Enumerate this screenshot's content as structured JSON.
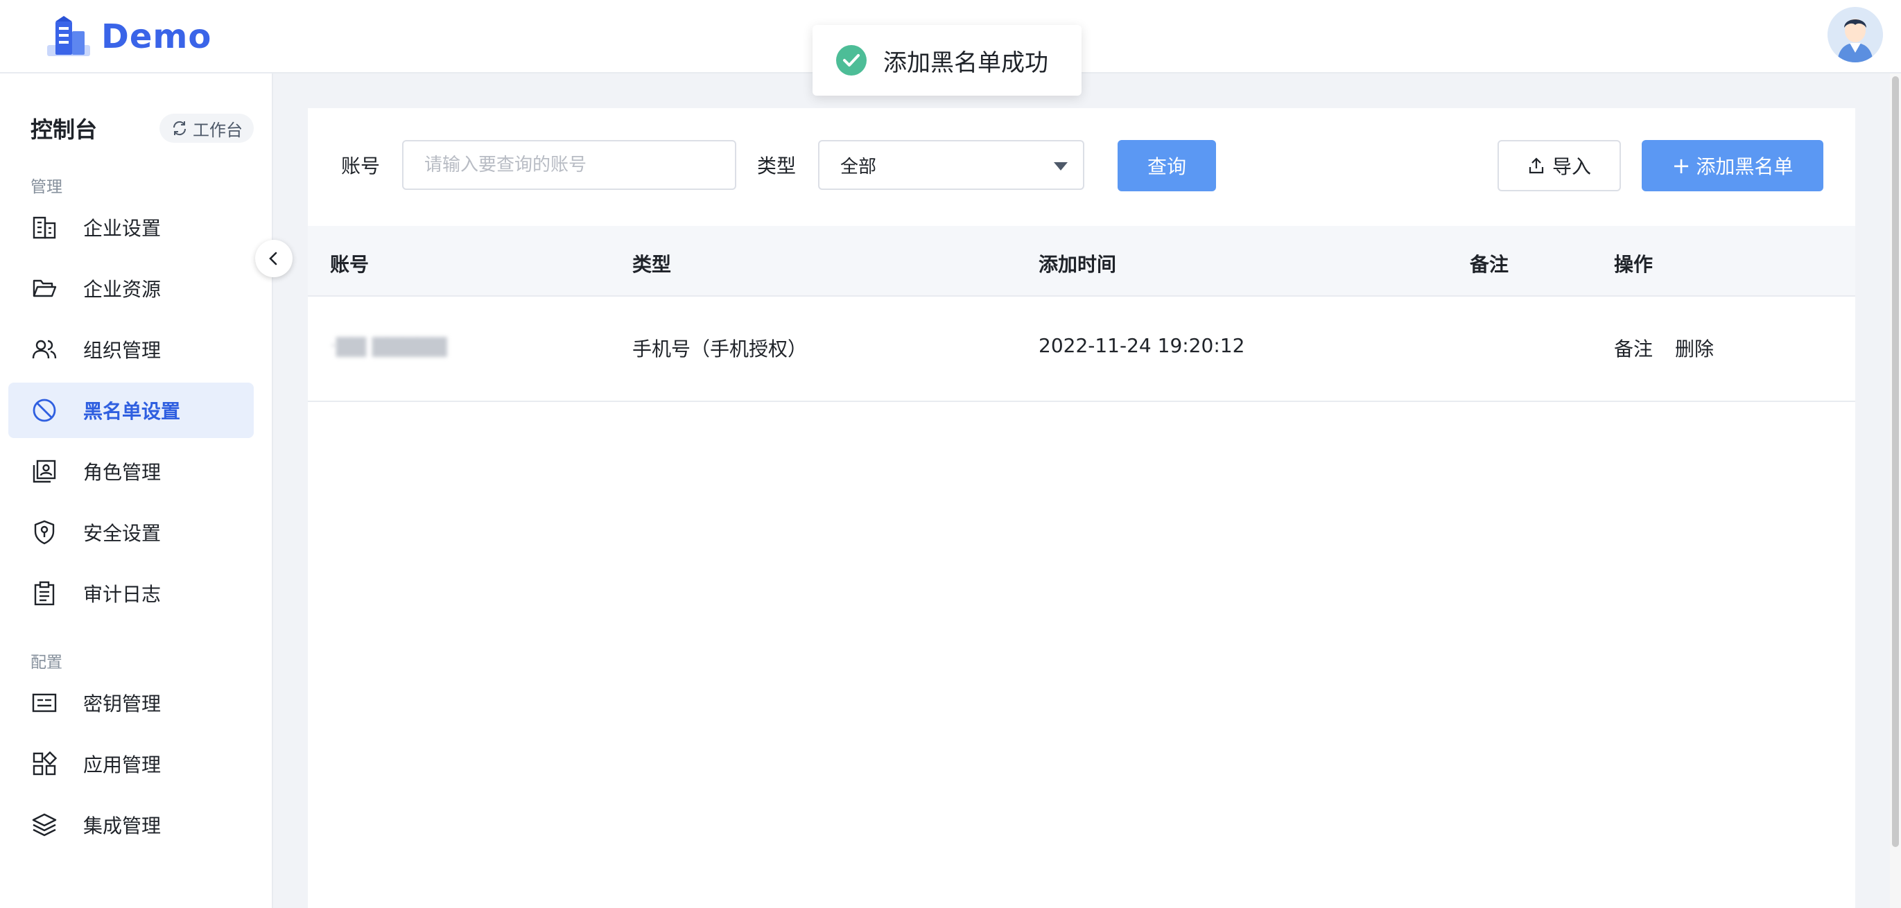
{
  "app": {
    "logo_text": "Demo"
  },
  "toast": {
    "message": "添加黑名单成功"
  },
  "sidebar": {
    "console_title": "控制台",
    "workbench_label": "工作台",
    "sections": [
      {
        "label": "管理"
      },
      {
        "label": "配置"
      }
    ],
    "items": [
      {
        "label": "企业设置",
        "icon": "building-icon"
      },
      {
        "label": "企业资源",
        "icon": "folder-open-icon"
      },
      {
        "label": "组织管理",
        "icon": "users-icon"
      },
      {
        "label": "黑名单设置",
        "icon": "ban-icon",
        "active": true
      },
      {
        "label": "角色管理",
        "icon": "id-card-icon"
      },
      {
        "label": "安全设置",
        "icon": "shield-key-icon"
      },
      {
        "label": "审计日志",
        "icon": "clipboard-icon"
      },
      {
        "label": "密钥管理",
        "icon": "key-card-icon"
      },
      {
        "label": "应用管理",
        "icon": "apps-grid-icon"
      },
      {
        "label": "集成管理",
        "icon": "layers-icon"
      }
    ]
  },
  "filters": {
    "account_label": "账号",
    "account_placeholder": "请输入要查询的账号",
    "account_value": "",
    "type_label": "类型",
    "type_value": "全部",
    "query_button": "查询",
    "import_button": "导入",
    "add_button": "添加黑名单"
  },
  "table": {
    "headers": [
      "账号",
      "类型",
      "添加时间",
      "备注",
      "操作"
    ],
    "rows": [
      {
        "account": "·▇▇   ▇▇▇▇▇",
        "type": "手机号（手机授权）",
        "added_at": "2022-11-24 19:20:12",
        "note": "",
        "actions": [
          "备注",
          "删除"
        ]
      }
    ]
  },
  "colors": {
    "primary": "#5b98f3",
    "active_text": "#2f5fe0",
    "active_bg": "#e8effc",
    "success": "#4dbd97",
    "logo": "#3a64e8"
  }
}
